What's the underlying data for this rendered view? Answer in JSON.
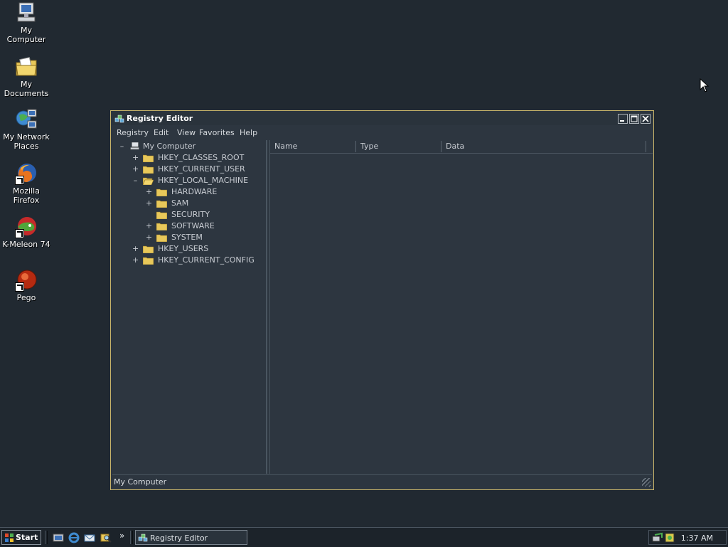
{
  "desktop": {
    "icons": [
      {
        "label": "My Computer"
      },
      {
        "label": "My Documents"
      },
      {
        "label": "My Network Places"
      },
      {
        "label": "Mozilla Firefox"
      },
      {
        "label": "K-Meleon 74"
      },
      {
        "label": "Pego"
      }
    ]
  },
  "window": {
    "title": "Registry Editor",
    "menu": [
      "Registry",
      "Edit",
      "View",
      "Favorites",
      "Help"
    ],
    "tree": {
      "root": "My Computer",
      "nodes": [
        {
          "label": "HKEY_CLASSES_ROOT",
          "expander": "+"
        },
        {
          "label": "HKEY_CURRENT_USER",
          "expander": "+"
        },
        {
          "label": "HKEY_LOCAL_MACHINE",
          "expander": "–"
        },
        {
          "label": "HARDWARE",
          "expander": "+"
        },
        {
          "label": "SAM",
          "expander": "+"
        },
        {
          "label": "SECURITY",
          "expander": ""
        },
        {
          "label": "SOFTWARE",
          "expander": "+"
        },
        {
          "label": "SYSTEM",
          "expander": "+"
        },
        {
          "label": "HKEY_USERS",
          "expander": "+"
        },
        {
          "label": "HKEY_CURRENT_CONFIG",
          "expander": "+"
        }
      ],
      "root_expander": "–"
    },
    "columns": [
      "Name",
      "Type",
      "Data"
    ],
    "status": "My Computer"
  },
  "taskbar": {
    "start_label": "Start",
    "chevron": "»",
    "task_label": "Registry Editor",
    "clock": "1:37 AM"
  },
  "colors": {
    "desktop": "#212931",
    "window_border": "#c8b46a",
    "folder": "#e8c85a"
  }
}
